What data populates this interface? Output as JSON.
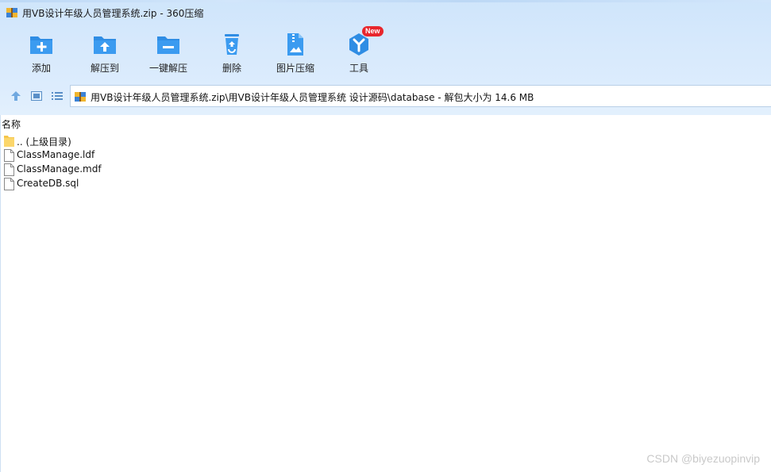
{
  "window": {
    "title": "用VB设计年级人员管理系统.zip - 360压缩"
  },
  "toolbar": {
    "items": [
      {
        "label": "添加",
        "icon": "add-icon"
      },
      {
        "label": "解压到",
        "icon": "extract-to-icon"
      },
      {
        "label": "一键解压",
        "icon": "one-click-extract-icon"
      },
      {
        "label": "删除",
        "icon": "delete-icon"
      },
      {
        "label": "图片压缩",
        "icon": "image-compress-icon"
      },
      {
        "label": "工具",
        "icon": "tools-icon",
        "badge": "New"
      }
    ]
  },
  "navbar": {
    "path": "用VB设计年级人员管理系统.zip\\用VB设计年级人员管理系统 设计源码\\database - 解包大小为 14.6 MB"
  },
  "filelist": {
    "column_name": "名称",
    "rows": [
      {
        "name": ".. (上级目录)",
        "type": "folder"
      },
      {
        "name": "ClassManage.ldf",
        "type": "file"
      },
      {
        "name": "ClassManage.mdf",
        "type": "file"
      },
      {
        "name": "CreateDB.sql",
        "type": "file"
      }
    ]
  },
  "watermark": "CSDN @biyezuopinvip",
  "colors": {
    "accent": "#2f8de4",
    "chrome_bg": "#d7e9fc",
    "badge": "#e8262c",
    "folder": "#f5c54a"
  }
}
